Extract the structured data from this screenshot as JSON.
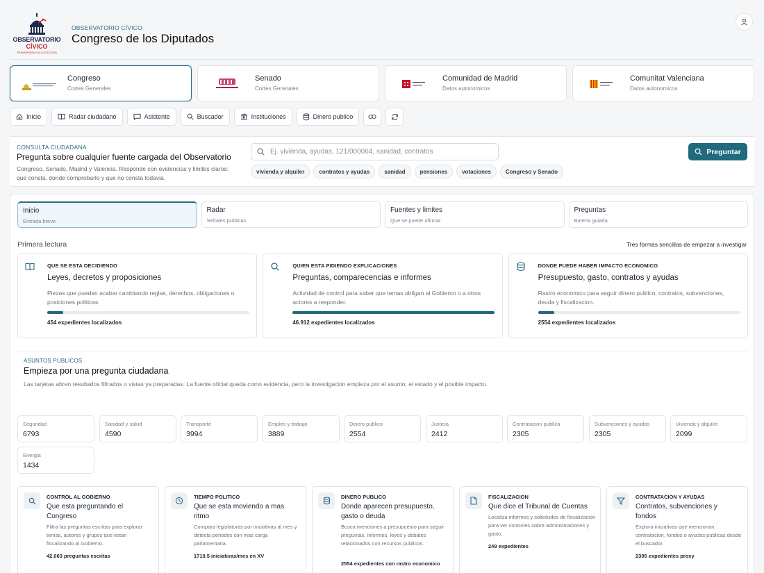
{
  "header": {
    "logo_line1": "OBSERVATORIO",
    "logo_line2": "CÍVICO",
    "logo_line3": "TRANSPARENCIA & ESCUCHA",
    "kicker": "OBSERVATORIO CÍVICO",
    "title": "Congreso de los Diputados",
    "user_icon": "user-icon"
  },
  "sources": [
    {
      "name": "Congreso",
      "sub": "Cortes Generales"
    },
    {
      "name": "Senado",
      "sub": "Cortes Generales"
    },
    {
      "name": "Comunidad de Madrid",
      "sub": "Datos autonomicos"
    },
    {
      "name": "Comunitat Valenciana",
      "sub": "Datos autonomicos"
    }
  ],
  "nav": [
    {
      "label": "Inicio",
      "icon": "home-icon"
    },
    {
      "label": "Radar ciudadano",
      "icon": "book-icon"
    },
    {
      "label": "Asistente",
      "icon": "chat-icon"
    },
    {
      "label": "Buscador",
      "icon": "search-icon"
    },
    {
      "label": "Instituciones",
      "icon": "institution-icon"
    },
    {
      "label": "Dinero publico",
      "icon": "database-icon"
    }
  ],
  "consulta": {
    "kicker": "CONSULTA CIUDADANA",
    "title": "Pregunta sobre cualquier fuente cargada del Observatorio",
    "desc": "Congreso, Senado, Madrid y Valencia. Responde con evidencias y limites claros: que consta, donde comprobarlo y que no consta todavia.",
    "search_placeholder": "Ej. vivienda, ayudas, 121/000064, sanidad, contratos",
    "chips": [
      "vivienda y alquiler",
      "contratos y ayudas",
      "sanidad",
      "pensiones",
      "votaciones",
      "Congreso y Senado"
    ],
    "ask_label": "Preguntar"
  },
  "tabs": [
    {
      "title": "Inicio",
      "sub": "Entrada breve"
    },
    {
      "title": "Radar",
      "sub": "Señales publicas"
    },
    {
      "title": "Fuentes y limites",
      "sub": "Que se puede afirmar"
    },
    {
      "title": "Preguntas",
      "sub": "Bateria guiada"
    }
  ],
  "primera": {
    "title": "Primera lectura",
    "right": "Tres formas sencillas de empezar a investigar"
  },
  "features": [
    {
      "kicker": "QUE SE ESTA DECIDIENDO",
      "title": "Leyes, decretos y proposiciones",
      "desc": "Piezas que pueden acabar cambiando reglas, derechos, obligaciones o posiciones politicas.",
      "count": "454 expedientes localizados",
      "progress": 0.08,
      "icon": "book-open-icon"
    },
    {
      "kicker": "QUIEN ESTA PIDIENDO EXPLICACIONES",
      "title": "Preguntas, comparecencias e informes",
      "desc": "Actividad de control para saber que temas obligan al Gobierno o a otros actores a responder.",
      "count": "46.912 expedientes localizados",
      "progress": 1.0,
      "icon": "search-icon"
    },
    {
      "kicker": "DONDE PUEDE HABER IMPACTO ECONOMICO",
      "title": "Presupuesto, gasto, contratos y ayudas",
      "desc": "Rastro economico para seguir dinero publico, contratos, subvenciones, deuda y fiscalizacion.",
      "count": "2554 expedientes localizados",
      "progress": 0.08,
      "icon": "database-icon"
    }
  ],
  "asuntos": {
    "kicker": "ASUNTOS PUBLICOS",
    "title": "Empieza por una pregunta ciudadana",
    "desc": "Las tarjetas abren resultados filtrados o vistas ya preparadas. La fuente oficial queda como evidencia, pero la investigacion empieza por el asunto, el estado y el posible impacto."
  },
  "stats": [
    {
      "label": "Seguridad",
      "value": "6793"
    },
    {
      "label": "Sanidad y salud",
      "value": "4590"
    },
    {
      "label": "Transporte",
      "value": "3994"
    },
    {
      "label": "Empleo y trabajo",
      "value": "3889"
    },
    {
      "label": "Dinero publico",
      "value": "2554"
    },
    {
      "label": "Justicia",
      "value": "2412"
    },
    {
      "label": "Contratacion publica",
      "value": "2305"
    },
    {
      "label": "Subvenciones y ayudas",
      "value": "2305"
    },
    {
      "label": "Vivienda y alquiler",
      "value": "2099"
    },
    {
      "label": "Energia",
      "value": "1434"
    }
  ],
  "cards": [
    {
      "kicker": "CONTROL AL GOBIERNO",
      "title": "Que esta preguntando el Congreso",
      "desc": "Filtra las preguntas escritas para explorar temas, autores y grupos que estan fiscalizando al Gobierno.",
      "metric": "42.063 preguntas escritas",
      "icon": "search-icon"
    },
    {
      "kicker": "TIEMPO POLITICO",
      "title": "Que se esta moviendo a mas ritmo",
      "desc": "Compara legislaturas por iniciativas al mes y detecta periodos con mas carga parlamentaria.",
      "metric": "1710.5 iniciativas/mes en XV",
      "icon": "clock-icon"
    },
    {
      "kicker": "DINERO PUBLICO",
      "title": "Donde aparecen presupuesto, gasto o deuda",
      "desc": "Busca menciones a presupuesto para seguir preguntas, informes, leyes y debates relacionados con recursos publicos.",
      "metric": "2554 expedientes con rastro economico",
      "icon": "database-icon"
    },
    {
      "kicker": "FISCALIZACION",
      "title": "Que dice el Tribunal de Cuentas",
      "desc": "Localiza informes y solicitudes de fiscalizacion para ver controles sobre administraciones y gasto.",
      "metric": "249 expedientes",
      "icon": "document-icon"
    },
    {
      "kicker": "CONTRATACION Y AYUDAS",
      "title": "Contratos, subvenciones y fondos",
      "desc": "Explora iniciativas que mencionan contratacion, fondos o ayudas publicas desde el buscador.",
      "metric": "2305 expedientes proxy",
      "icon": "filter-icon"
    }
  ]
}
